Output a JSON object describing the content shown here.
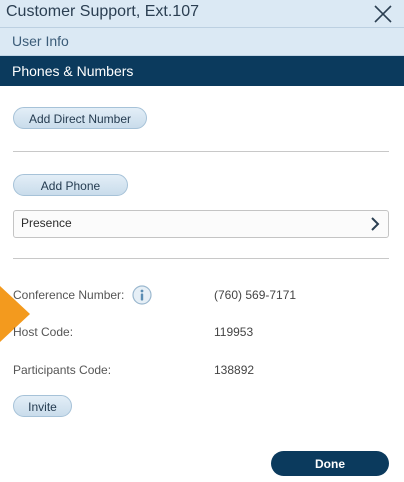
{
  "window": {
    "title": "Customer Support, Ext.107",
    "close_icon": "close-icon"
  },
  "nav": {
    "user_info": "User Info",
    "section": "Phones & Numbers"
  },
  "actions": {
    "add_direct_number": "Add Direct Number",
    "add_phone": "Add Phone",
    "invite": "Invite",
    "done": "Done"
  },
  "presence": {
    "label": "Presence",
    "icon": "chevron-right-icon"
  },
  "conference": {
    "number_label": "Conference Number:",
    "number_value": "(760) 569-7171",
    "host_label": "Host Code:",
    "host_value": "119953",
    "participants_label": "Participants Code:",
    "participants_value": "138892",
    "info_icon": "info-icon"
  },
  "colors": {
    "header_bg": "#dbe9f4",
    "section_bg": "#0b3a5d",
    "accent_arrow": "#f39a1e",
    "button_bg": "#d6e6f2"
  }
}
